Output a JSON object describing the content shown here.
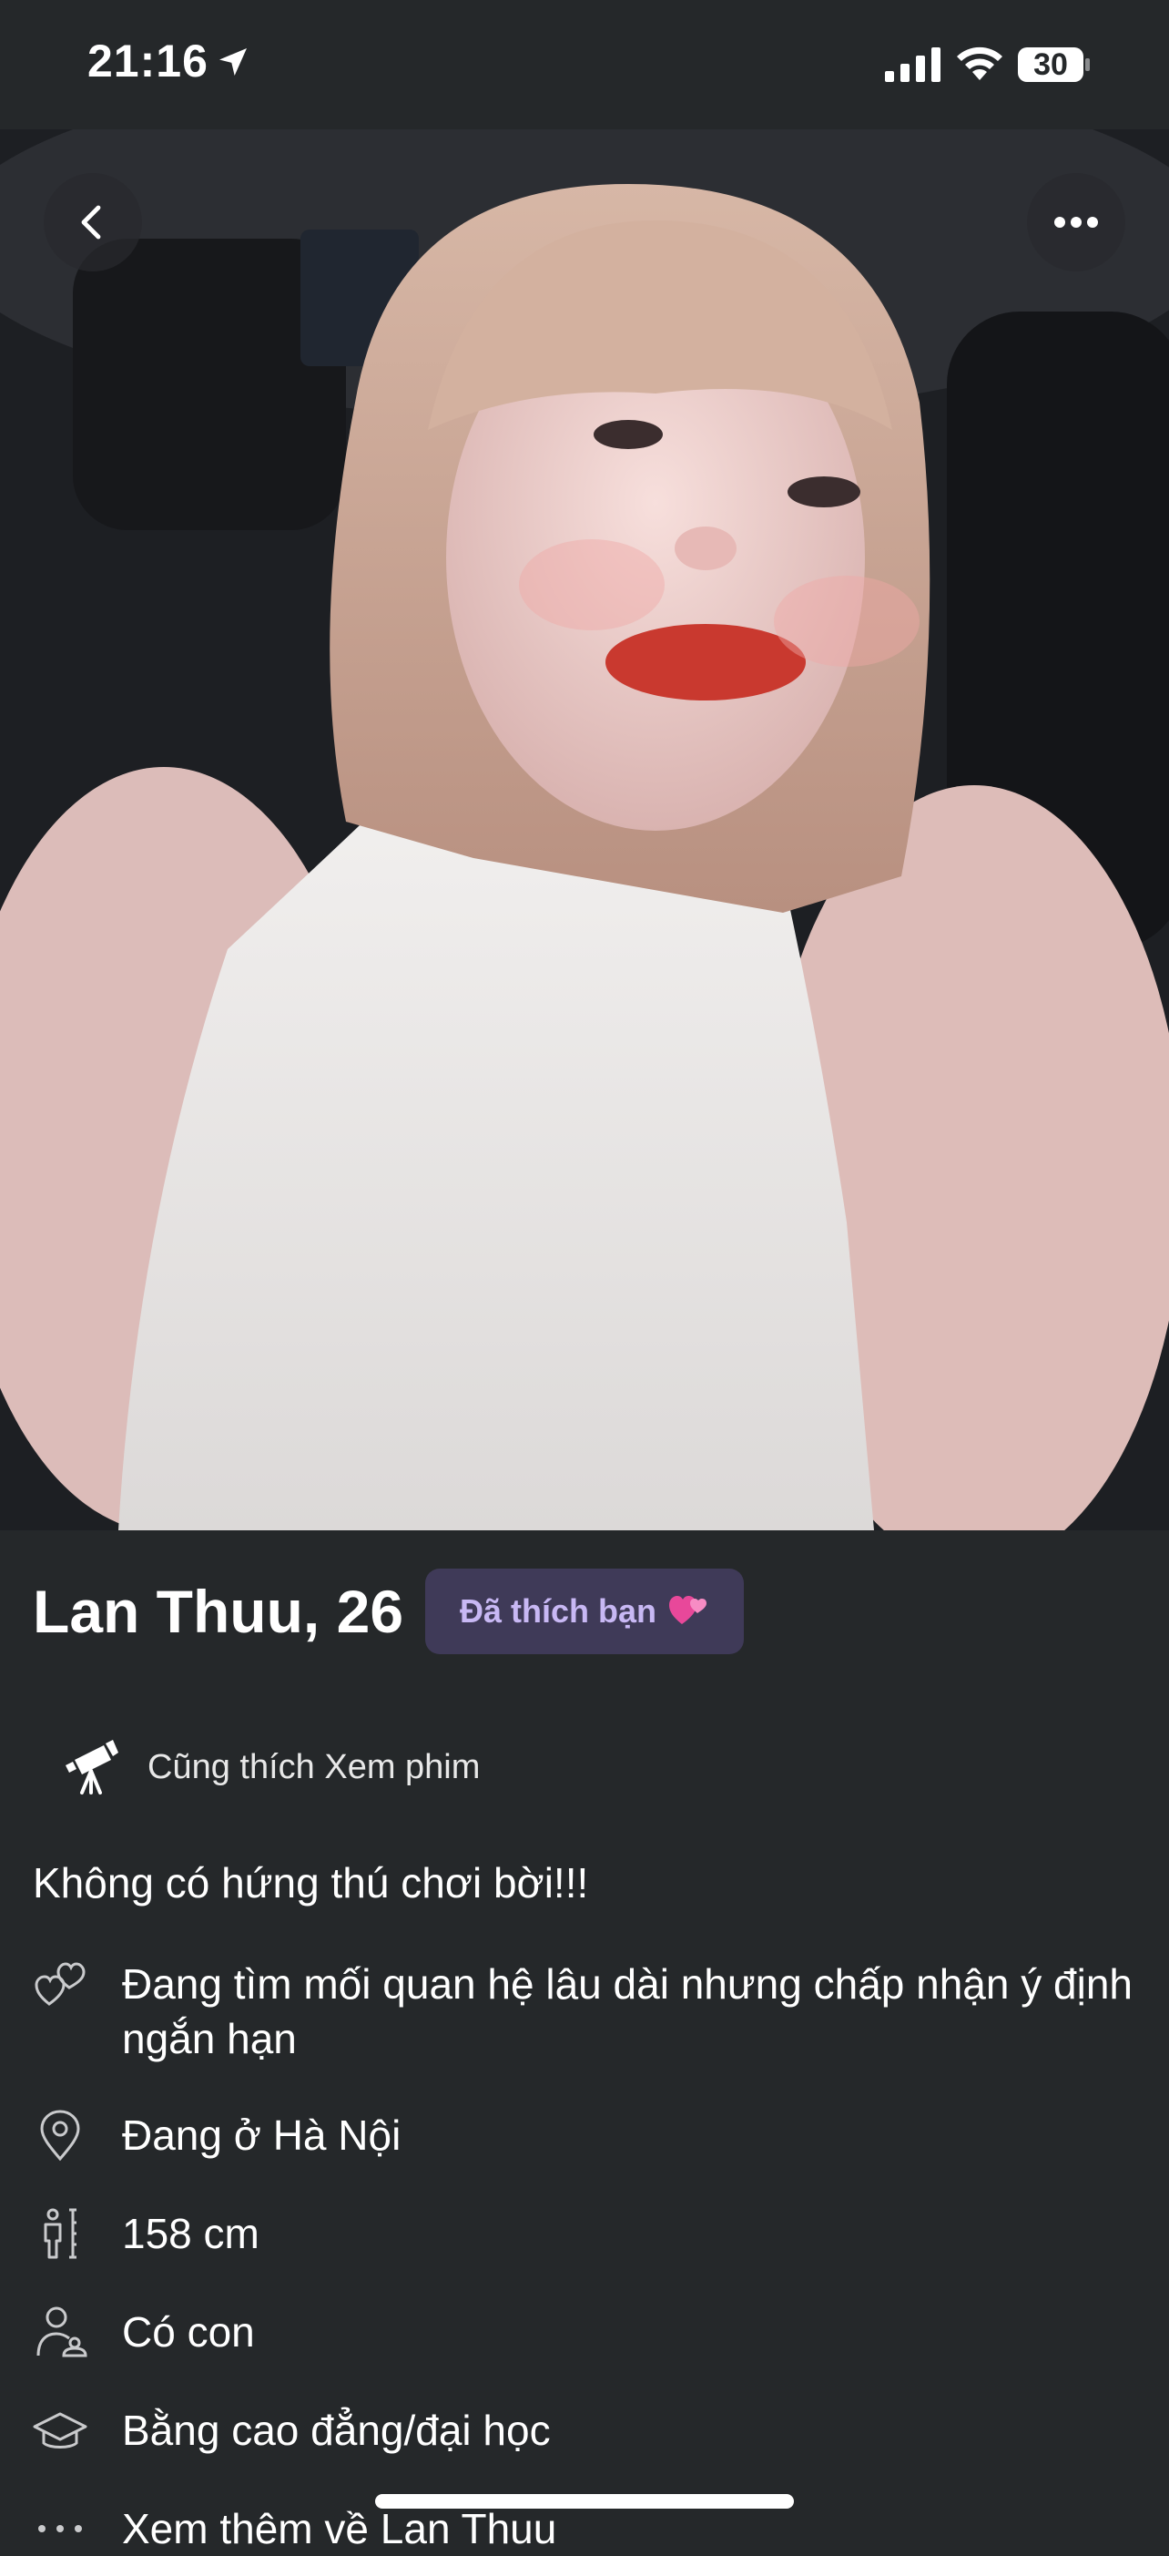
{
  "status_bar": {
    "time": "21:16",
    "battery": "30",
    "icons": [
      "location-arrow-icon",
      "cellular-signal-icon",
      "wifi-icon",
      "battery-icon"
    ]
  },
  "photo": {
    "back_icon": "chevron-left-icon",
    "more_icon": "more-dots-icon"
  },
  "profile": {
    "name_age": "Lan Thuu, 26",
    "liked_badge": "Đã thích bạn",
    "liked_badge_icon": "two-hearts-icon",
    "shared_interest": "Cũng thích Xem phim",
    "shared_interest_icon": "telescope-icon",
    "bio": "Không có hứng thú chơi bời!!!",
    "details": [
      {
        "icon": "hearts-icon",
        "text": "Đang tìm mối quan hệ lâu dài nhưng chấp nhận ý định ngắn hạn"
      },
      {
        "icon": "location-pin-icon",
        "text": "Đang ở Hà Nội"
      },
      {
        "icon": "height-icon",
        "text": "158 cm"
      },
      {
        "icon": "person-child-icon",
        "text": "Có con"
      },
      {
        "icon": "graduation-cap-icon",
        "text": "Bằng cao đẳng/đại học"
      },
      {
        "icon": "more-dots-icon",
        "text": "Xem thêm về Lan Thuu"
      }
    ]
  },
  "colors": {
    "background": "#25282a",
    "badge_bg": "#3f3a58",
    "badge_text": "#c8b8f4"
  }
}
